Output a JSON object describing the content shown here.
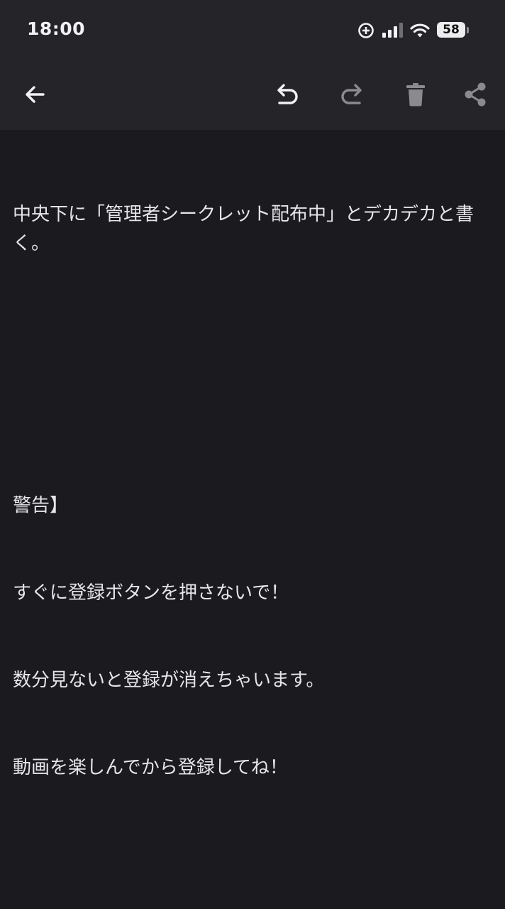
{
  "status_bar": {
    "time": "18:00",
    "battery": "58",
    "icons": [
      "focus-icon",
      "signal-icon",
      "wifi-icon",
      "battery-icon"
    ]
  },
  "toolbar": {
    "back_icon": "arrow-left-icon",
    "undo_icon": "undo-icon",
    "redo_icon": "redo-icon",
    "delete_icon": "trash-icon",
    "share_icon": "share-icon"
  },
  "note": {
    "paragraph1": "中央下に「管理者シークレット配布中」とデカデカと書く。",
    "lines": [
      "警告】",
      "すぐに登録ボタンを押さないで！",
      "数分見ないと登録が消えちゃいます。",
      "動画を楽しんでから登録してね！"
    ]
  },
  "colors": {
    "background": "#1a1a1f",
    "header": "#242429",
    "text": "#e6e6e8",
    "icon_active": "#f2f2f4",
    "icon_disabled": "#8a8a8f"
  }
}
